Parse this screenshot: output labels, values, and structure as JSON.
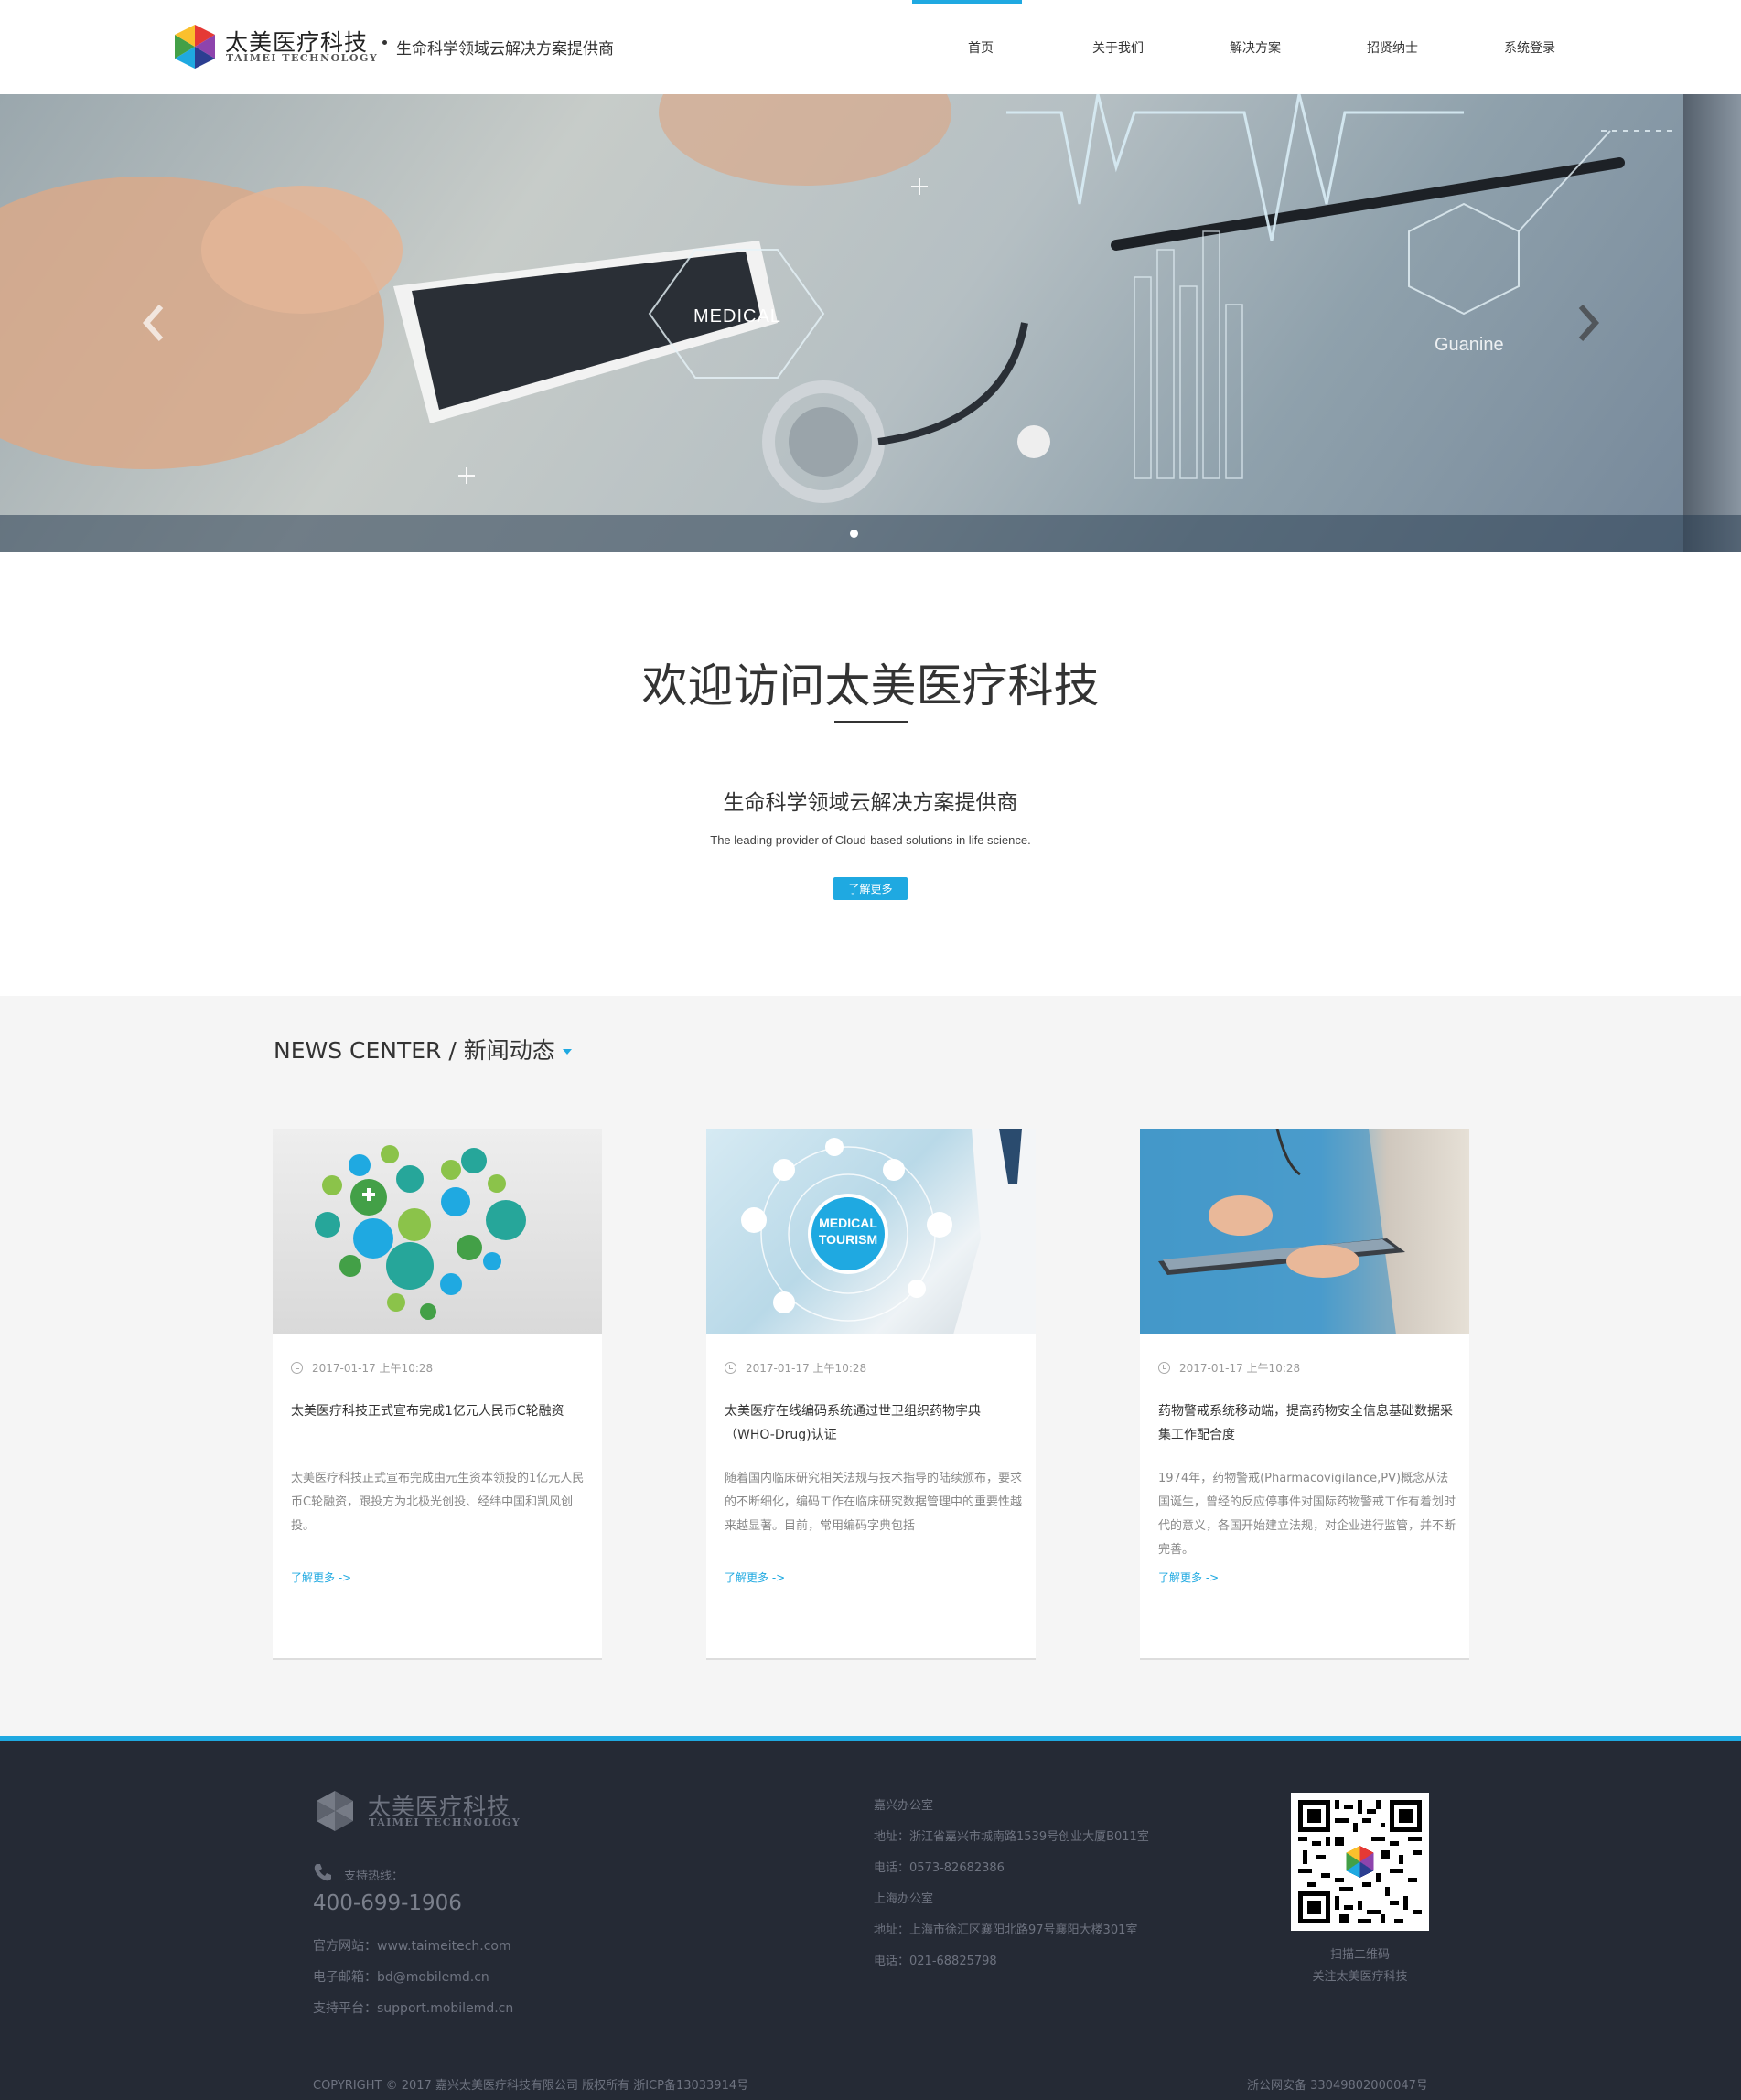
{
  "header": {
    "brand_cn": "太美医疗科技",
    "brand_en": "TAIMEI TECHNOLOGY",
    "tagline": "生命科学领域云解决方案提供商",
    "nav": [
      {
        "label": "首页",
        "active": true
      },
      {
        "label": "关于我们"
      },
      {
        "label": "解决方案"
      },
      {
        "label": "招贤纳士"
      },
      {
        "label": "系统登录"
      }
    ]
  },
  "hero": {
    "medical_label": "MEDICAL",
    "guanine_label": "Guanine",
    "slide_count": 1,
    "active_slide": 1
  },
  "welcome": {
    "title": "欢迎访问太美医疗科技",
    "subtitle": "生命科学领域云解决方案提供商",
    "subtitle_en": "The leading provider of Cloud-based solutions in life science.",
    "button": "了解更多"
  },
  "news": {
    "heading": "NEWS CENTER / 新闻动态",
    "cards": [
      {
        "image_label": "",
        "date": "2017-01-17 上午10:28",
        "title": "太美医疗科技正式宣布完成1亿元人民币C轮融资",
        "text": "太美医疗科技正式宣布完成由元生资本领投的1亿元人民币C轮融资，跟投方为北极光创投、经纬中国和凯风创投。",
        "more": "了解更多 ->"
      },
      {
        "image_label": "MEDICAL TOURISM",
        "date": "2017-01-17 上午10:28",
        "title": "太美医疗在线编码系统通过世卫组织药物字典（WHO-Drug)认证",
        "text": "随着国内临床研究相关法规与技术指导的陆续颁布，要求的不断细化，编码工作在临床研究数据管理中的重要性越来越显著。目前，常用编码字典包括",
        "more": "了解更多 ->"
      },
      {
        "image_label": "",
        "date": "2017-01-17 上午10:28",
        "title": "药物警戒系统移动端，提高药物安全信息基础数据采集工作配合度",
        "text": "1974年，药物警戒(Pharmacovigilance,PV)概念从法国诞生，曾经的反应停事件对国际药物警戒工作有着划时代的意义，各国开始建立法规，对企业进行监管，并不断完善。",
        "more": "了解更多 ->"
      }
    ]
  },
  "footer": {
    "brand_cn": "太美医疗科技",
    "brand_en": "TAIMEI TECHNOLOGY",
    "hotline_label": "支持热线：",
    "hotline": "400-699-1906",
    "website": "官方网站：www.taimeitech.com",
    "email": "电子邮箱：bd@mobilemd.cn",
    "support": "支持平台：support.mobilemd.cn",
    "office1_name": "嘉兴办公室",
    "office1_address": "地址：浙江省嘉兴市城南路1539号创业大厦B011室",
    "office1_phone": "电话：0573-82682386",
    "office2_name": "上海办公室",
    "office2_address": "地址：上海市徐汇区襄阳北路97号襄阳大楼301室",
    "office2_phone": "电话：021-68825798",
    "qr_caption1": "扫描二维码",
    "qr_caption2": "关注太美医疗科技",
    "copyright": "COPYRIGHT © 2017 嘉兴太美医疗科技有限公司 版权所有 浙ICP备13033914号",
    "police": "浙公网安备 33049802000047号"
  },
  "colors": {
    "accent": "#1fa9e1",
    "footer_bg": "#252a35",
    "news_bg": "#f5f5f5"
  }
}
